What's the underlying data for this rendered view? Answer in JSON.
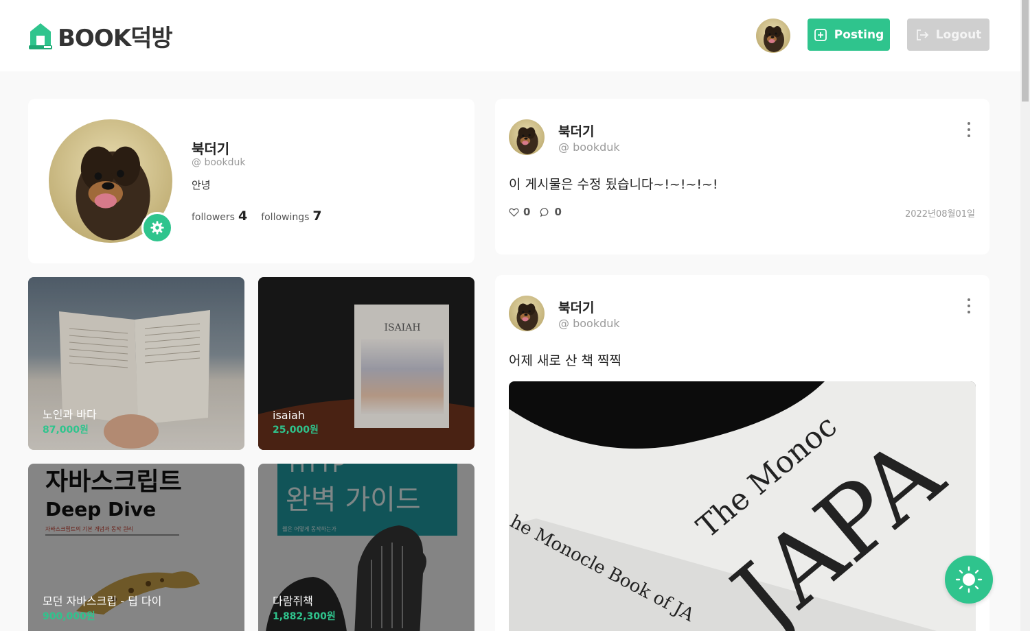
{
  "header": {
    "logo_text": "BOOK덕방",
    "posting_label": "Posting",
    "logout_label": "Logout"
  },
  "profile": {
    "name": "북더기",
    "handle": "@ bookduk",
    "intro": "안녕",
    "followers_label": "followers",
    "followers_count": "4",
    "followings_label": "followings",
    "followings_count": "7"
  },
  "products": [
    {
      "name": "노인과 바다",
      "price": "87,000원"
    },
    {
      "name": "isaiah",
      "price": "25,000원"
    },
    {
      "name": "모던 자바스크립 - 딥 다이",
      "price": "900,000원"
    },
    {
      "name": "다람쥐책",
      "price": "1,882,300원"
    }
  ],
  "product_images": {
    "isaiah_cover": "ISAIAH",
    "js_cover_title": "자바스크립트",
    "js_cover_subtitle": "Deep Dive",
    "js_cover_desc": "자바스크립트의 기본 개념과 동작 원리",
    "http_cover_title": "HTTP",
    "http_cover_subtitle": "완벽 가이드",
    "http_cover_desc": "웹은 어떻게 동작하는가"
  },
  "posts": [
    {
      "name": "북더기",
      "handle": "@ bookduk",
      "content": "이 게시물은 수정 됬습니다~!~!~!~!",
      "likes": "0",
      "comments": "0",
      "date": "2022년08월01일"
    },
    {
      "name": "북더기",
      "handle": "@ bookduk",
      "content": "어제 새로 산 책 찍찍",
      "image_text_1": "The Monoc",
      "image_text_2": "JAPA",
      "image_text_3": "he Monocle Book of JA"
    }
  ],
  "colors": {
    "accent": "#2fc48d",
    "logout_bg": "#cfcfcf",
    "background": "#f9f9f9"
  }
}
